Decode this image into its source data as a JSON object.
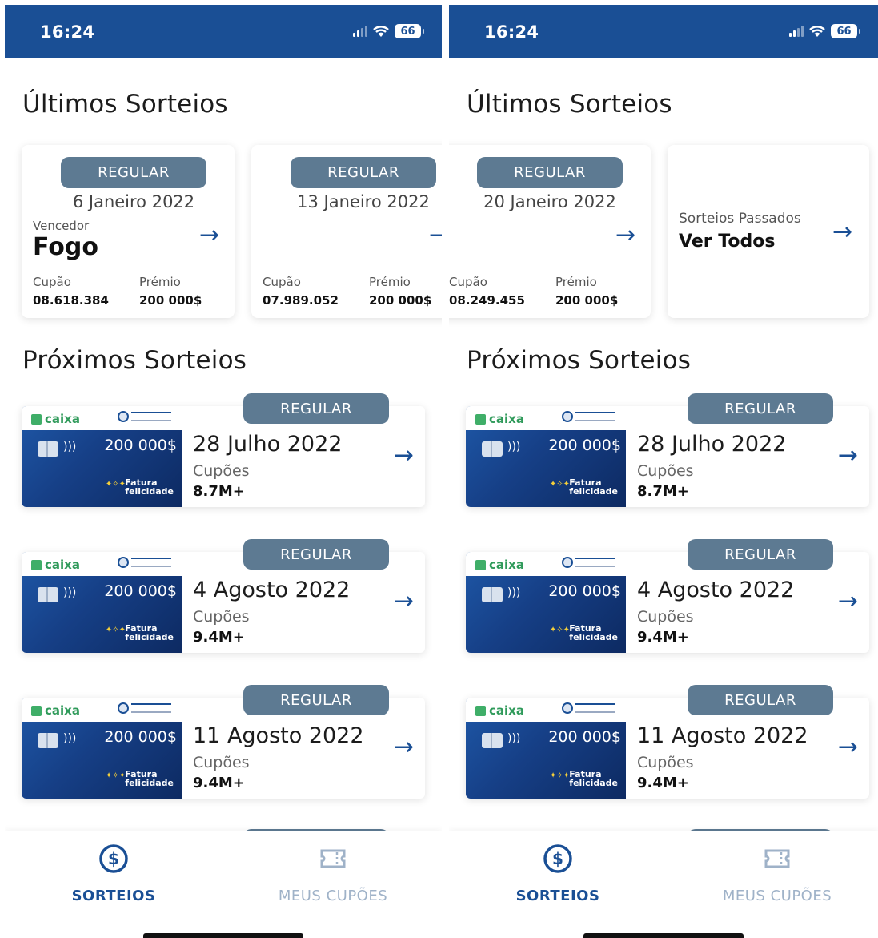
{
  "status": {
    "time": "16:24",
    "battery": "66"
  },
  "titles": {
    "latest": "Últimos Sorteios",
    "upcoming": "Próximos Sorteios"
  },
  "labels": {
    "winner": "Vencedor",
    "coupon": "Cupão",
    "prize": "Prémio",
    "coupons": "Cupões",
    "regular": "REGULAR",
    "arrow": "→"
  },
  "latest_draws": [
    {
      "date": "6 Janeiro 2022",
      "winner": "Fogo",
      "coupon": "08.618.384",
      "prize": "200 000$"
    },
    {
      "date": "13 Janeiro 2022",
      "coupon": "07.989.052",
      "prize": "200 000$"
    },
    {
      "date": "20 Janeiro 2022",
      "coupon": "08.249.455",
      "prize": "200 000$"
    }
  ],
  "past": {
    "label": "Sorteios Passados",
    "link": "Ver Todos"
  },
  "ticket": {
    "brand": "caixa",
    "amount": "200 000$",
    "logo_line1": "Fatura",
    "logo_line2": "felicidade"
  },
  "upcoming_draws": [
    {
      "date": "28 Julho 2022",
      "coupons": "8.7M+"
    },
    {
      "date": "4 Agosto 2022",
      "coupons": "9.4M+"
    },
    {
      "date": "11 Agosto 2022",
      "coupons": "9.4M+"
    }
  ],
  "nav": {
    "draws": "SORTEIOS",
    "coupons": "MEUS CUPÕES"
  },
  "colors": {
    "brand": "#1a4f95",
    "pill": "#5d7a92",
    "inactive": "#9fb2c8"
  },
  "icons": {
    "draws": "dollar-circle-icon",
    "coupons": "ticket-icon",
    "go": "arrow-right-icon"
  }
}
